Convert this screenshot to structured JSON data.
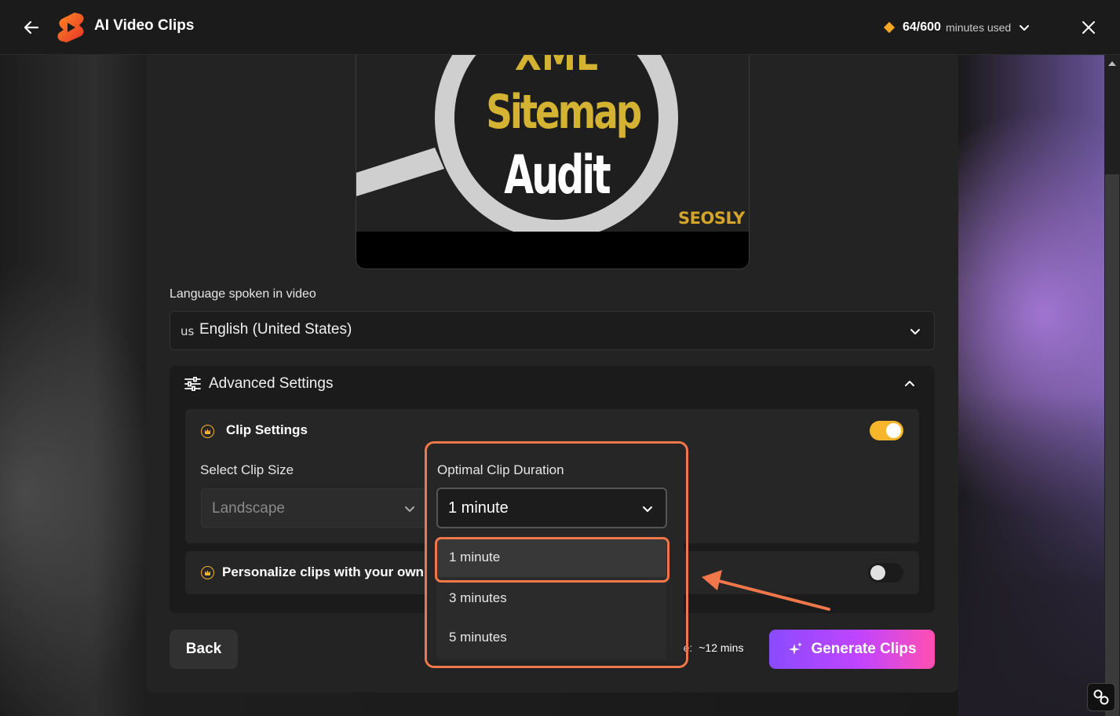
{
  "header": {
    "title": "AI Video Clips",
    "usage_count": "64/600",
    "usage_unit": "minutes used"
  },
  "thumbnail": {
    "line1": "XML",
    "line2": "Sitemap",
    "line3": "Audit",
    "brand": "SEOSLY"
  },
  "language": {
    "label": "Language spoken in video",
    "flag": "us",
    "value": "English (United States)"
  },
  "advanced": {
    "title": "Advanced Settings",
    "clip_settings": {
      "title": "Clip Settings",
      "enabled": true,
      "size_label": "Select Clip Size",
      "size_value": "Landscape",
      "duration_label": "Optimal Clip Duration",
      "duration_value": "1 minute",
      "duration_options": [
        "1 minute",
        "3 minutes",
        "5 minutes"
      ]
    },
    "personalize": {
      "title": "Personalize clips with your own",
      "enabled": false
    }
  },
  "footer": {
    "back_label": "Back",
    "usage_prefix": "sage:",
    "usage_value": "~12 mins",
    "generate_label": "Generate Clips"
  },
  "colors": {
    "accent_orange": "#f5b62b",
    "annotation": "#f0774a",
    "generate_gradient_start": "#8a4bff",
    "generate_gradient_end": "#ff4fb1"
  }
}
